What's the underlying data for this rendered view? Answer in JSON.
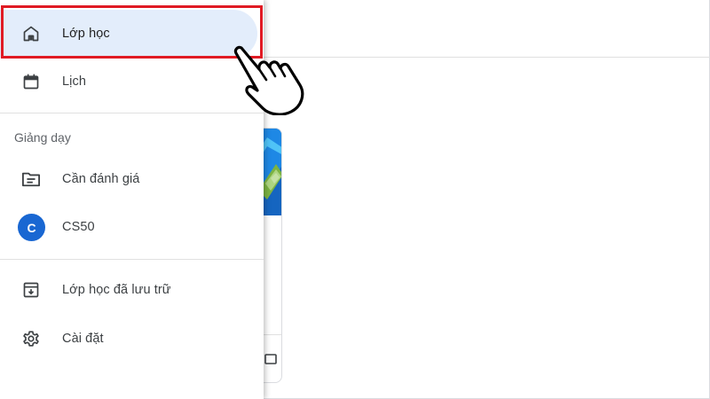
{
  "drawer": {
    "primary_items": [
      {
        "label": "Lớp học",
        "icon": "home-icon",
        "active": true
      },
      {
        "label": "Lịch",
        "icon": "calendar-icon",
        "active": false
      }
    ],
    "section_title": "Giảng dạy",
    "teaching_items": [
      {
        "label": "Cần đánh giá",
        "icon": "folder-icon"
      },
      {
        "label": "CS50",
        "avatar_letter": "C",
        "avatar_color": "#1967d2"
      }
    ],
    "bottom_items": [
      {
        "label": "Lớp học đã lưu trữ",
        "icon": "archive-icon"
      },
      {
        "label": "Cài đặt",
        "icon": "settings-icon"
      }
    ]
  },
  "colors": {
    "active_bg": "#e3edfb",
    "highlight": "#e01b24",
    "card_banner": "#1e88e5"
  }
}
